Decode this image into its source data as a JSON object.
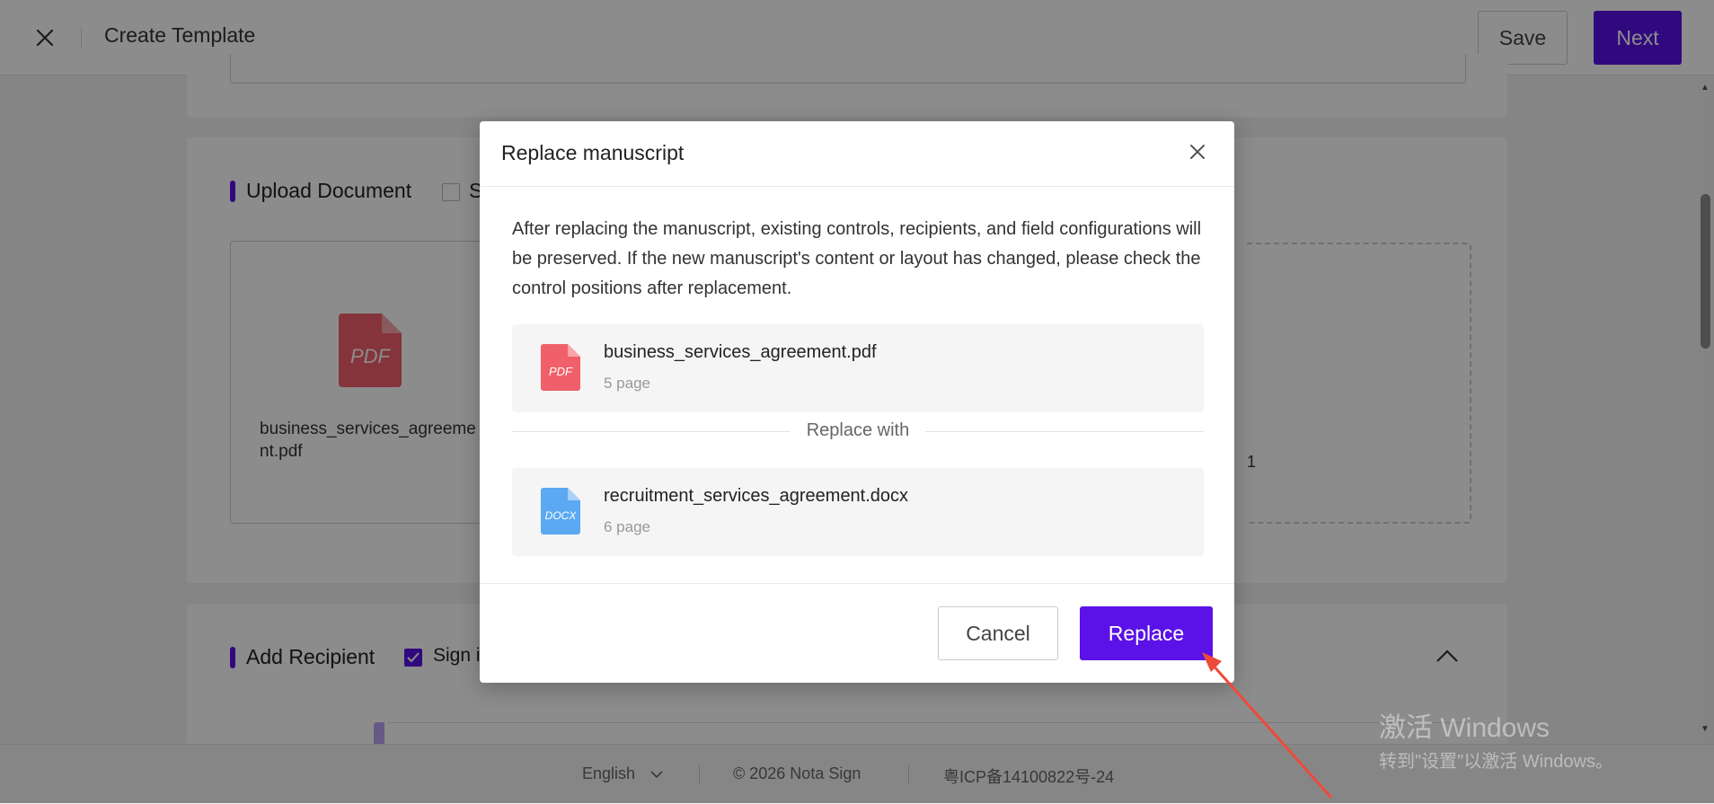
{
  "header": {
    "title": "Create Template",
    "save_label": "Save",
    "next_label": "Next"
  },
  "upload_section": {
    "title": "Upload Document",
    "checkbox_label_partial": "S",
    "document": {
      "name": "business_services_agreement.pdf",
      "icon": "pdf-file-icon",
      "icon_text": "PDF"
    },
    "stray_char": "1"
  },
  "recipient_section": {
    "title": "Add Recipient",
    "checkbox_label_partial": "Sign i"
  },
  "modal": {
    "title": "Replace manuscript",
    "description": "After replacing the manuscript, existing controls, recipients, and field configurations will be preserved. If the new manuscript's content or layout has changed, please check the control positions after replacement.",
    "current_file": {
      "name": "business_services_agreement.pdf",
      "pages": "5 page",
      "icon": "pdf-file-icon",
      "icon_text": "PDF"
    },
    "divider_label": "Replace with",
    "new_file": {
      "name": "recruitment_services_agreement.docx",
      "pages": "6 page",
      "icon": "docx-file-icon",
      "icon_text": "DOCX"
    },
    "cancel_label": "Cancel",
    "replace_label": "Replace"
  },
  "footer": {
    "language": "English",
    "copyright": "© 2026 Nota Sign",
    "icp": "粤ICP备14100822号-24"
  },
  "watermark": {
    "line1": "激活 Windows",
    "line2": "转到\"设置\"以激活 Windows。"
  },
  "colors": {
    "accent": "#5a12e8",
    "pdf_red": "#f0606a",
    "docx_blue": "#5aa9f2"
  }
}
